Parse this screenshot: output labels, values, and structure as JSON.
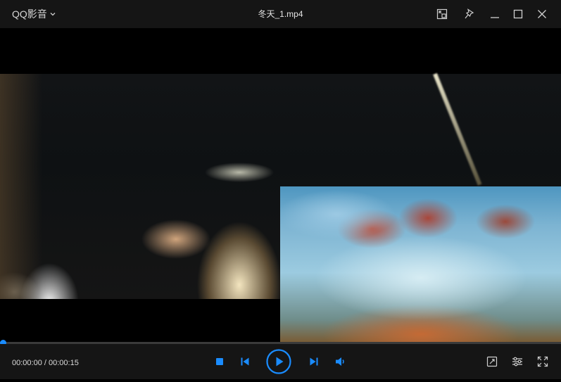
{
  "app": {
    "menu_label": "QQ影音",
    "menu_icon": "chevron-down-icon"
  },
  "window": {
    "title": "冬天_1.mp4",
    "buttons": [
      "mini-mode-icon",
      "pin-icon",
      "minimize-icon",
      "maximize-icon",
      "close-icon"
    ]
  },
  "player": {
    "time_display": "00:00:00 / 00:00:15",
    "current_time": "00:00:00",
    "total_time": "00:00:15",
    "progress_fraction": 0,
    "accent_color": "#1a8cff",
    "controls": [
      "stop-icon",
      "previous-icon",
      "play-icon",
      "next-icon",
      "volume-icon"
    ],
    "right_controls": [
      "screenshot-icon",
      "settings-icon",
      "fullscreen-icon"
    ]
  }
}
